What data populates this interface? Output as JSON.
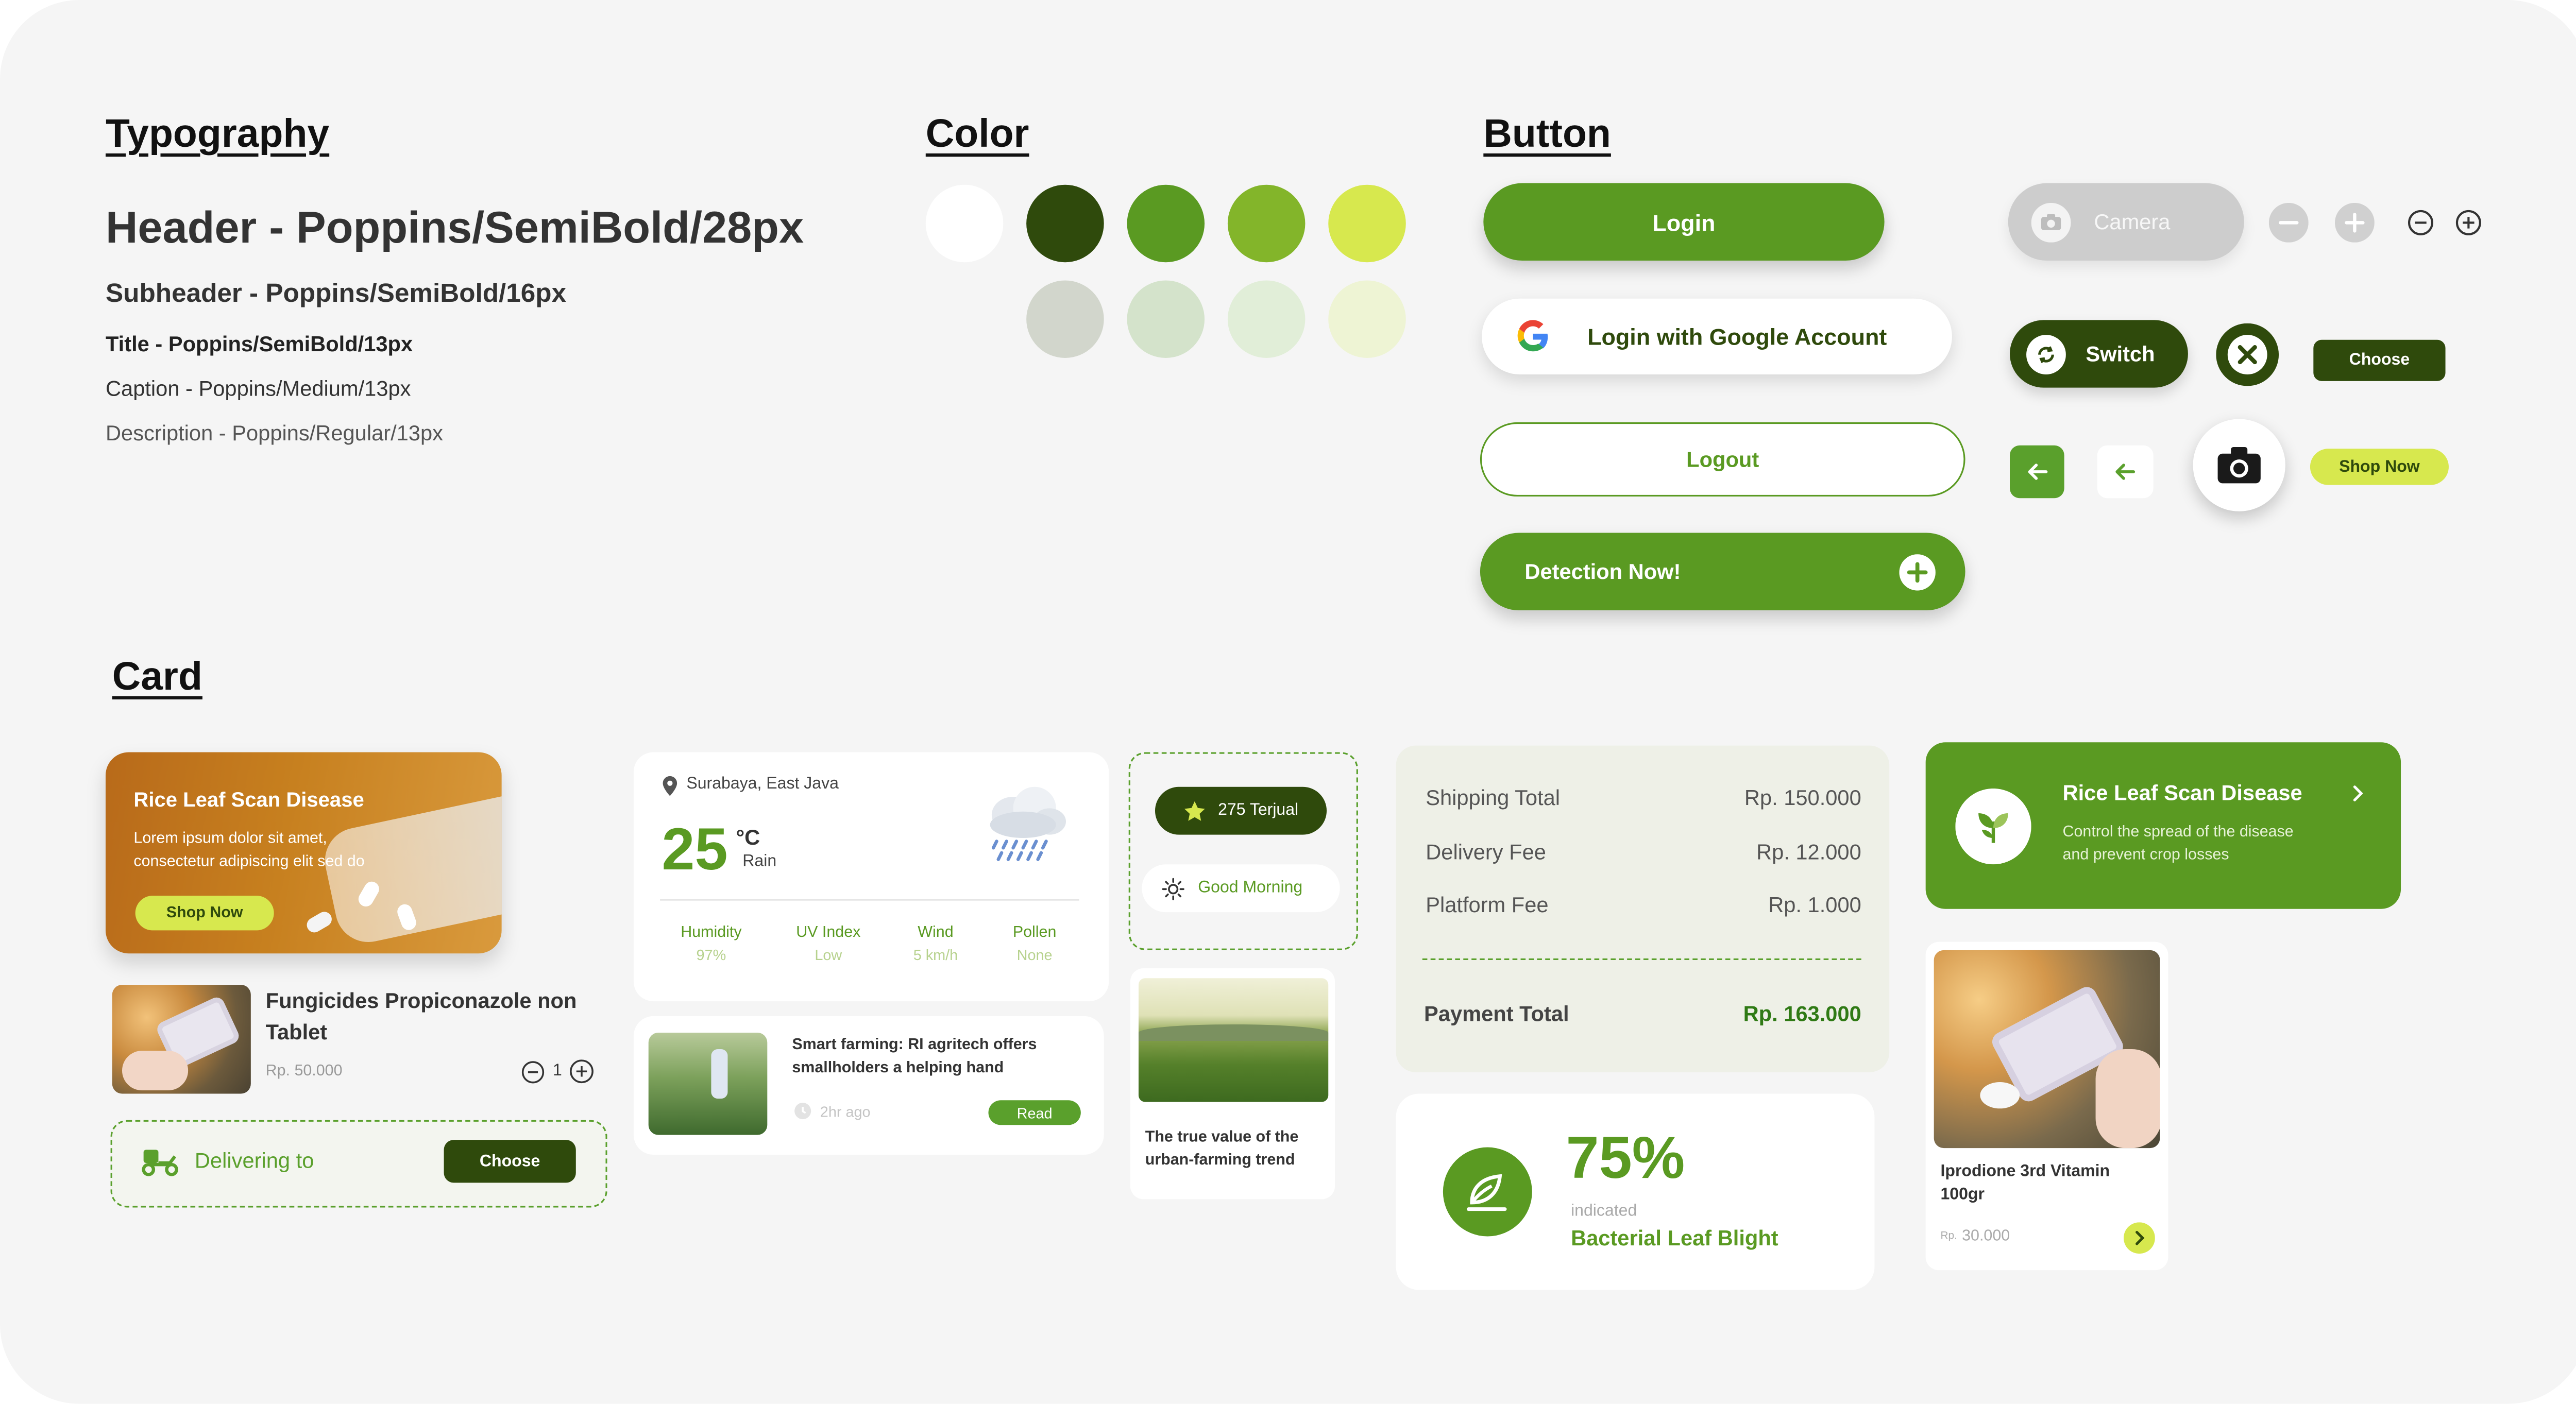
{
  "colors": {
    "primary": "#5a9a22",
    "dark": "#2f4a0c",
    "light_green": "#83b52a",
    "lime": "#d7e84e",
    "palette_row1": [
      "#ffffff",
      "#2f4a0c",
      "#5a9a22",
      "#83b52a",
      "#d7e84e"
    ],
    "palette_row2": [
      "#d2d6cc",
      "#d4e3cb",
      "#e1eed8",
      "#eef4d4"
    ]
  },
  "sections": {
    "typography": "Typography",
    "color": "Color",
    "button": "Button",
    "card": "Card"
  },
  "typography": {
    "header": "Header - Poppins/SemiBold/28px",
    "subheader": "Subheader - Poppins/SemiBold/16px",
    "title": "Title - Poppins/SemiBold/13px",
    "caption": "Caption - Poppins/Medium/13px",
    "description": "Description - Poppins/Regular/13px"
  },
  "buttons": {
    "login": "Login",
    "google_login": "Login with Google Account",
    "logout": "Logout",
    "detection": "Detection Now!",
    "camera": "Camera",
    "switch": "Switch",
    "choose": "Choose",
    "shop_now": "Shop Now"
  },
  "icons": {
    "minus": "minus-circle-icon",
    "plus": "plus-circle-icon",
    "close": "close-icon",
    "back": "arrow-left-icon",
    "camera": "camera-icon",
    "google": "google-icon",
    "add": "plus-icon"
  },
  "promo_card": {
    "title": "Rice Leaf Scan Disease",
    "desc_line1": "Lorem ipsum dolor sit amet,",
    "desc_line2": "consectetur adipiscing elit sed do",
    "cta": "Shop Now"
  },
  "product_item": {
    "name_line1": "Fungicides Propiconazole non",
    "name_line2": "Tablet",
    "price": "Rp. 50.000",
    "quantity": "1"
  },
  "delivery": {
    "label": "Delivering to",
    "button": "Choose"
  },
  "weather": {
    "location": "Surabaya, East Java",
    "temperature": "25",
    "unit": "°C",
    "condition": "Rain",
    "stats": [
      {
        "label": "Humidity",
        "value": "97%"
      },
      {
        "label": "UV Index",
        "value": "Low"
      },
      {
        "label": "Wind",
        "value": "5 km/h"
      },
      {
        "label": "Pollen",
        "value": "None"
      }
    ]
  },
  "news": {
    "title_line1": "Smart farming: RI agritech offers",
    "title_line2": "smallholders a helping hand",
    "time": "2hr ago",
    "action": "Read"
  },
  "chips": {
    "sold": "275 Terjual",
    "greeting": "Good Morning"
  },
  "article": {
    "title_line1": "The true value of the",
    "title_line2": "urban-farming trend"
  },
  "summary": {
    "rows": [
      {
        "label": "Shipping Total",
        "value": "Rp. 150.000"
      },
      {
        "label": "Delivery Fee",
        "value": "Rp. 12.000"
      },
      {
        "label": "Platform Fee",
        "value": "Rp. 1.000"
      }
    ],
    "total_label": "Payment Total",
    "total_value": "Rp. 163.000"
  },
  "detection_result": {
    "percent": "75%",
    "caption": "indicated",
    "disease": "Bacterial Leaf Blight"
  },
  "feature_card": {
    "title": "Rice Leaf Scan Disease",
    "desc_line1": "Control the spread of the disease",
    "desc_line2": "and prevent crop losses"
  },
  "product_card": {
    "name_line1": "Iprodione 3rd Vitamin",
    "name_line2": "100gr",
    "price_prefix": "Rp.",
    "price": "30.000"
  }
}
